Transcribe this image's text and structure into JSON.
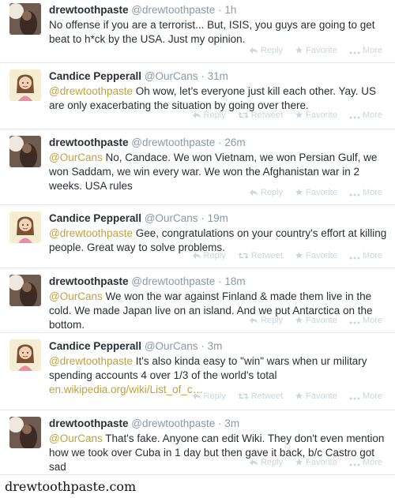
{
  "actions": {
    "reply": "Reply",
    "retweet": "Retweet",
    "favorite": "Favorite",
    "more": "More"
  },
  "tweets": [
    {
      "name": "drewtoothpaste",
      "handle": "@drewtoothpaste",
      "sep": "·",
      "time": "1h",
      "mention": "",
      "text": "No offense if you are a terrorist... But, ISIS, you guys are going to get beat to h*ck by the USA. Just my opinion.",
      "link": ""
    },
    {
      "name": "Candice Pepperall",
      "handle": "@OurCans",
      "sep": "·",
      "time": "31m",
      "mention": "@drewtoothpaste",
      "text": " Oh wow, let's everyone just kill each other. Yay. US are only exacerbating the situation by going over there.",
      "link": ""
    },
    {
      "name": "drewtoothpaste",
      "handle": "@drewtoothpaste",
      "sep": "·",
      "time": "26m",
      "mention": "@OurCans",
      "text": " No, Candace. We won Vietnam, we won Persian Gulf, we won Saddam, we win every war. We won the Afghanistan war in 2 weeks. USA rules",
      "link": ""
    },
    {
      "name": "Candice Pepperall",
      "handle": "@OurCans",
      "sep": "·",
      "time": "19m",
      "mention": "@drewtoothpaste",
      "text": " Gee, congratulations on your country's effort at killing people. Great way to solve problems.",
      "link": ""
    },
    {
      "name": "drewtoothpaste",
      "handle": "@drewtoothpaste",
      "sep": "·",
      "time": "18m",
      "mention": "@OurCans",
      "text": " We won the war against Finland & made them live in the cold. We made Japan live on an island. And we put Antarctica on the bottom.",
      "link": ""
    },
    {
      "name": "Candice Pepperall",
      "handle": "@OurCans",
      "sep": "·",
      "time": "3m",
      "mention": "@drewtoothpaste",
      "text": " It's also kinda easy to \"win\" wars when ur military spending accounts 4 over 1/3 of the world's total",
      "link": "en.wikipedia.org/wiki/List_of_c…"
    },
    {
      "name": "drewtoothpaste",
      "handle": "@drewtoothpaste",
      "sep": "·",
      "time": "3m",
      "mention": "@OurCans",
      "text": " That's fake. Anyone can edit Wiki. They don't even mention how we took over Cuba in 1 day but then gave it back, b/c Castro got sad",
      "link": ""
    }
  ],
  "footer": {
    "site": "drewtoothpaste.com"
  }
}
